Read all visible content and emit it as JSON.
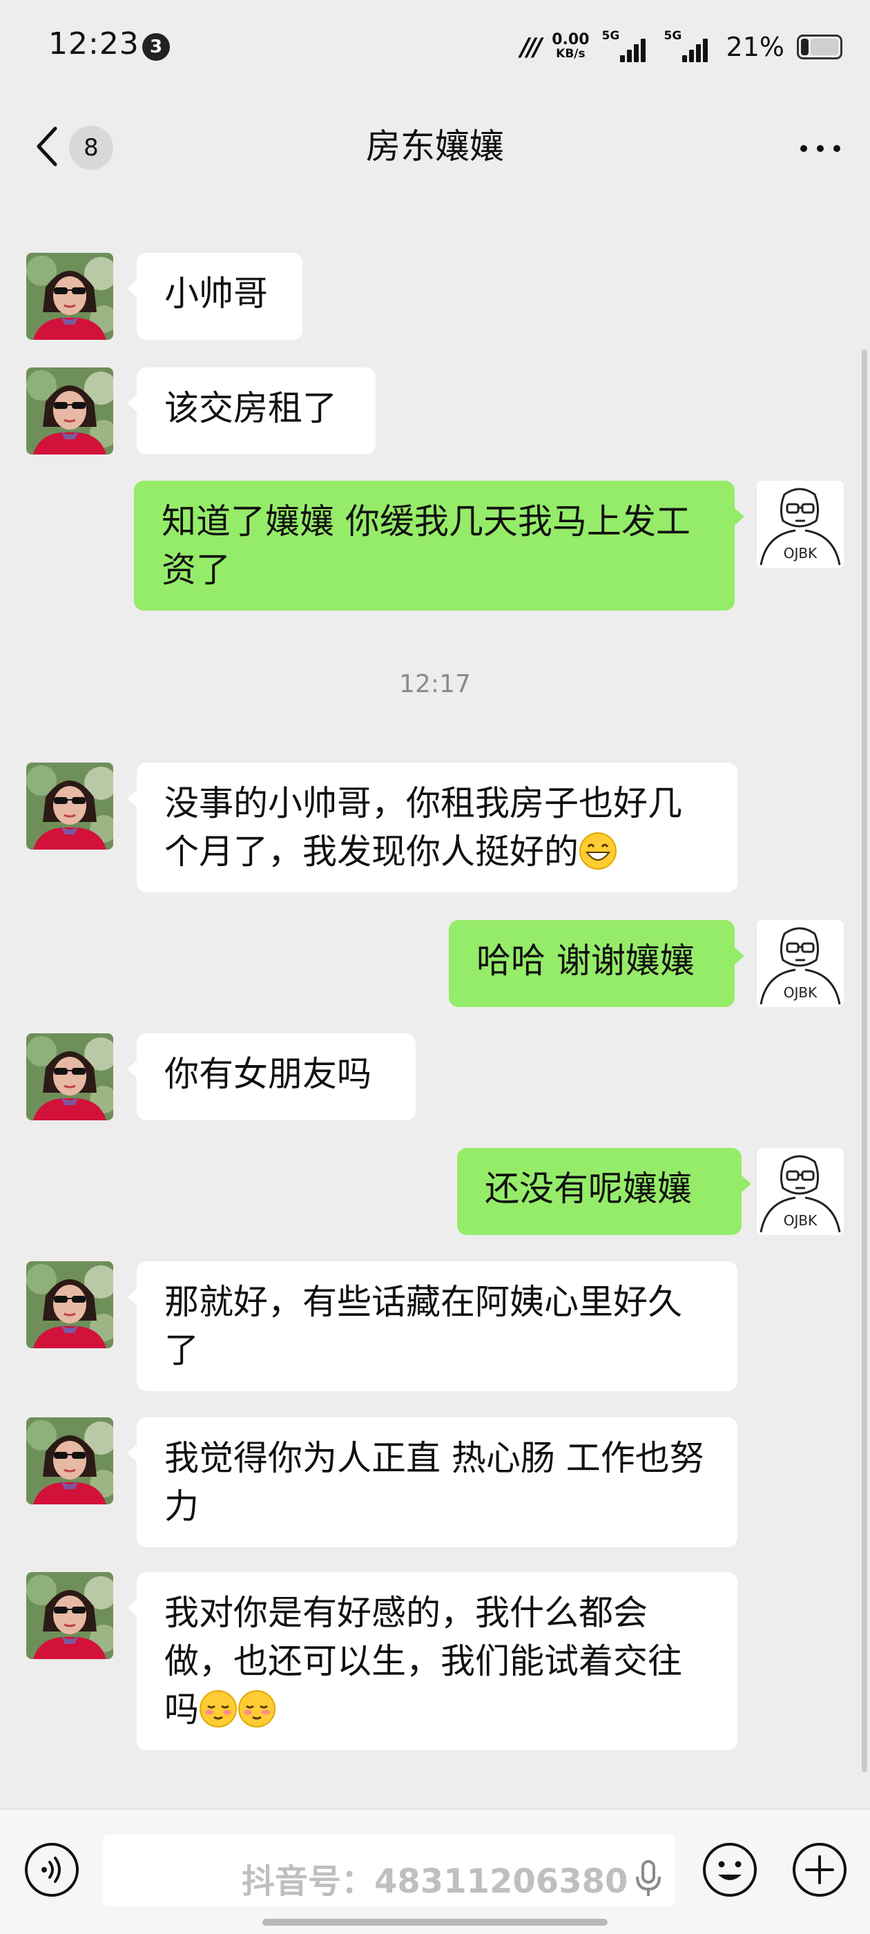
{
  "status_bar": {
    "time": "12:23",
    "notification_count": "3",
    "network_speed_value": "0.00",
    "network_speed_unit": "KB/s",
    "signal_1_label": "5G",
    "signal_2_label": "5G",
    "battery_percent": "21%",
    "battery_level": 0.21
  },
  "nav": {
    "unread_count": "8",
    "title": "房东孃孃"
  },
  "messages": [
    {
      "side": "in",
      "text": "小帅哥"
    },
    {
      "side": "in",
      "text": "该交房租了"
    },
    {
      "side": "out",
      "text": "知道了孃孃 你缓我几天我马上发工资了"
    },
    {
      "side": "time",
      "text": "12:17"
    },
    {
      "side": "in",
      "text": "没事的小帅哥，你租我房子也好几个月了，我发现你人挺好的",
      "emoji": [
        "grin-emoji"
      ]
    },
    {
      "side": "out",
      "text": "哈哈 谢谢孃孃"
    },
    {
      "side": "in",
      "text": "你有女朋友吗"
    },
    {
      "side": "out",
      "text": "还没有呢孃孃"
    },
    {
      "side": "in",
      "text": "那就好，有些话藏在阿姨心里好久了"
    },
    {
      "side": "in",
      "text": "我觉得你为人正直 热心肠 工作也努力"
    },
    {
      "side": "in",
      "text": "我对你是有好感的，我什么都会做，也还可以生，我们能试着交往吗",
      "emoji": [
        "blush-emoji",
        "blush-emoji"
      ]
    }
  ],
  "avatar_label_out": "OJBK",
  "input": {
    "value": "",
    "placeholder": ""
  },
  "watermark": "抖音号：48311206380",
  "colors": {
    "background": "#ededed",
    "incoming_bubble": "#ffffff",
    "outgoing_bubble": "#95ec69",
    "timestamp": "#8a8a8a"
  },
  "icons": [
    "back-arrow-icon",
    "more-dots-icon",
    "voice-icon",
    "microphone-icon",
    "emoji-icon",
    "plus-icon"
  ]
}
